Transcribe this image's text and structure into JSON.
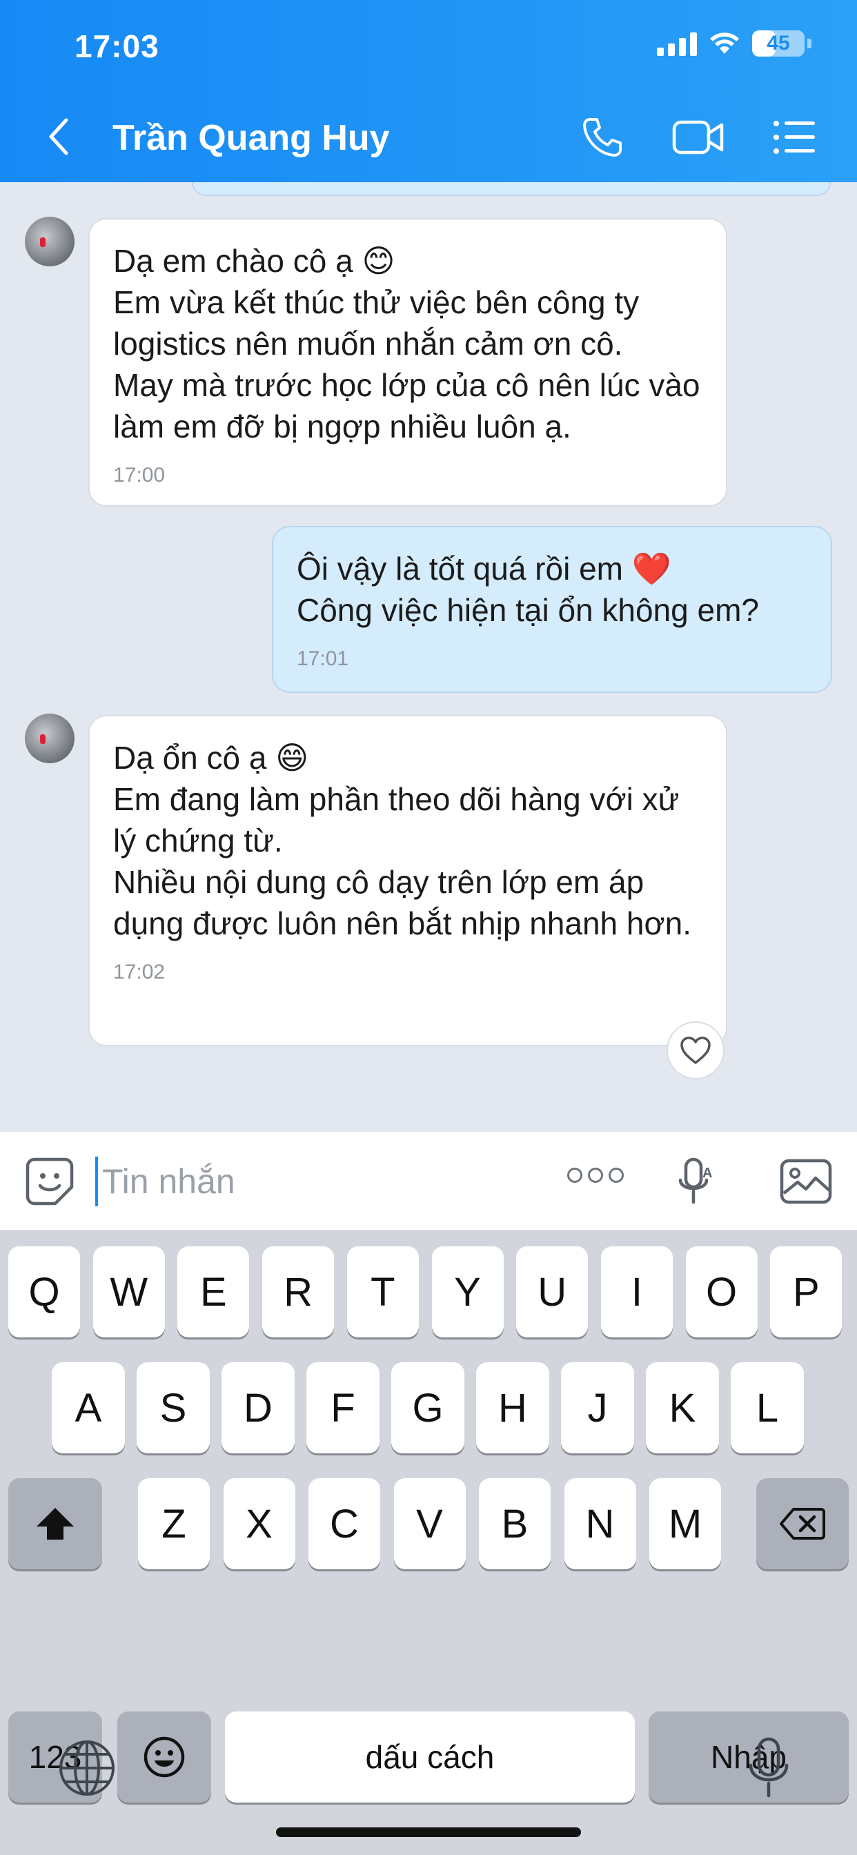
{
  "status_bar": {
    "time": "17:03",
    "battery_level": "45"
  },
  "header": {
    "contact_name": "Trần Quang Huy"
  },
  "messages": [
    {
      "direction": "in",
      "text": "Dạ em chào cô ạ 😊\nEm vừa kết thúc thử việc bên công ty logistics nên muốn nhắn cảm ơn cô.\nMay mà trước học lớp của cô nên lúc vào làm em đỡ bị ngợp nhiều luôn ạ.",
      "time": "17:00"
    },
    {
      "direction": "out",
      "text": "Ôi vậy là tốt quá rồi em ❤️\nCông việc hiện tại ổn không em?",
      "time": "17:01"
    },
    {
      "direction": "in",
      "text": "Dạ ổn cô ạ 😄\nEm đang làm phần theo dõi hàng với xử lý chứng từ.\nNhiều nội dung cô dạy trên lớp em áp dụng được luôn nên bắt nhịp nhanh hơn.",
      "time": "17:02"
    }
  ],
  "input": {
    "placeholder": "Tin nhắn",
    "value": ""
  },
  "keyboard": {
    "row1": [
      "Q",
      "W",
      "E",
      "R",
      "T",
      "Y",
      "U",
      "I",
      "O",
      "P"
    ],
    "row2": [
      "A",
      "S",
      "D",
      "F",
      "G",
      "H",
      "J",
      "K",
      "L"
    ],
    "row3": [
      "Z",
      "X",
      "C",
      "V",
      "B",
      "N",
      "M"
    ],
    "numbers_label": "123",
    "space_label": "dấu cách",
    "return_label": "Nhập"
  }
}
